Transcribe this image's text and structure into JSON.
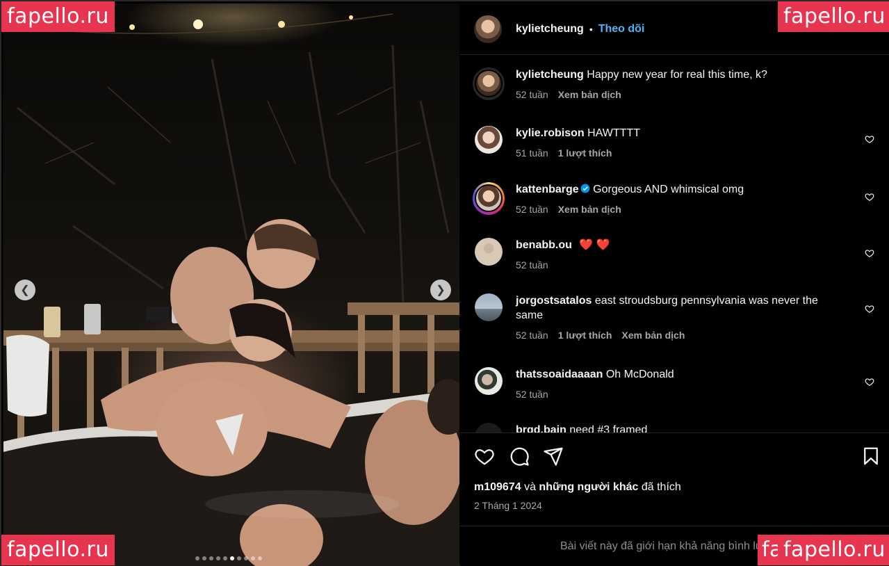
{
  "watermark": "fapello.ru",
  "header": {
    "username": "kylietcheung",
    "separator": "•",
    "follow_label": "Theo dõi"
  },
  "caption": {
    "username": "kylietcheung",
    "text": "Happy new year for real this time, k?",
    "time": "52 tuần",
    "translate": "Xem bản dịch"
  },
  "comments": [
    {
      "username": "kylie.robison",
      "text": "HAWTTTT",
      "time": "51 tuần",
      "likes": "1 lượt thích"
    },
    {
      "username": "kattenbarge",
      "text": "Gorgeous AND whimsical omg",
      "time": "52 tuần",
      "translate": "Xem bản dịch"
    },
    {
      "username": "benabb.ou",
      "text": "❤️ ❤️",
      "time": "52 tuần"
    },
    {
      "username": "jorgostsatalos",
      "text": "east stroudsburg pennsylvania was never the same",
      "time": "52 tuần",
      "likes": "1 lượt thích",
      "translate": "Xem bản dịch"
    },
    {
      "username": "thatssoaidaaaan",
      "text": "Oh McDonald",
      "time": "52 tuần"
    },
    {
      "username": "brgd.bain",
      "text": "need #3 framed"
    }
  ],
  "actions": {
    "liked_by_user": "m109674",
    "liked_by_rest": " và ",
    "liked_by_others": "những người khác",
    "liked_suffix": " đã thích",
    "date": "2 Tháng 1 2024"
  },
  "footer": {
    "text": "Bài viết này đã giới hạn khả năng bình luận."
  },
  "carousel": {
    "total": 10,
    "active": 6
  },
  "colors": {
    "accent": "#4cb5f9",
    "watermark_bg": "#e8354f"
  },
  "icons": [
    "chevron-left-icon",
    "chevron-right-icon",
    "heart-icon",
    "comment-icon",
    "share-icon",
    "bookmark-icon",
    "verified-icon"
  ]
}
